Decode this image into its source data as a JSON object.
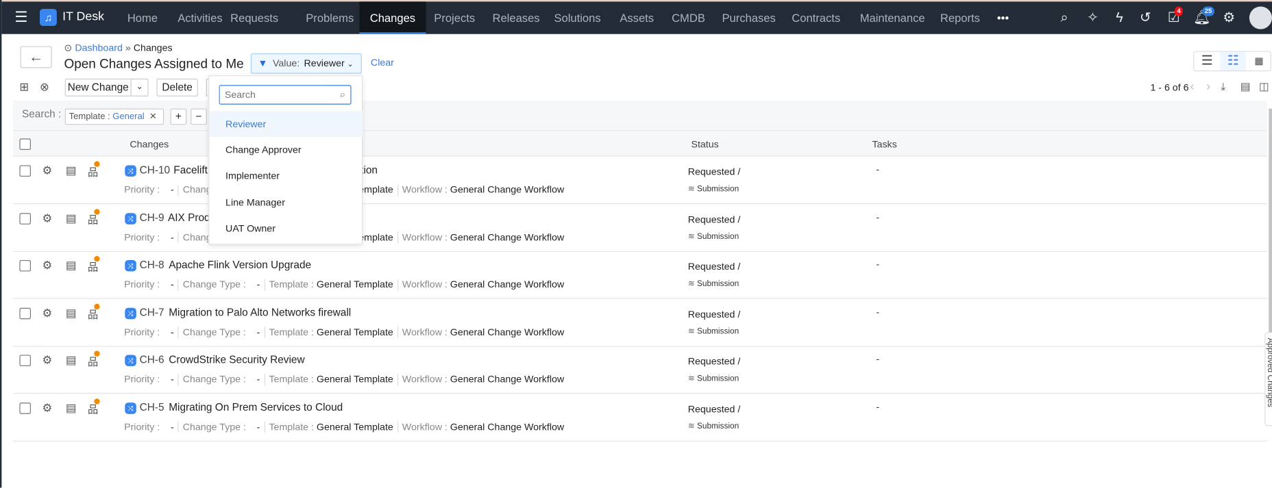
{
  "app": {
    "title": "IT Desk",
    "icon": "headset-icon"
  },
  "nav": {
    "items": [
      "Home",
      "Activities",
      "Requests",
      "Problems",
      "Changes",
      "Projects",
      "Releases",
      "Solutions",
      "Assets",
      "CMDB",
      "Purchases",
      "Contracts",
      "Maintenance",
      "Reports"
    ],
    "active": "Changes",
    "more": "•••"
  },
  "topbar": {
    "tasks_badge": "4",
    "notifications_badge": "25",
    "badge_colors": {
      "tasks": "#e8131b",
      "notifications": "#2f7de1"
    }
  },
  "breadcrumb": {
    "parent": "Dashboard",
    "current": "Changes"
  },
  "page": {
    "title": "Open Changes Assigned to Me"
  },
  "filter": {
    "label": "Value:",
    "value": "Reviewer",
    "clear": "Clear"
  },
  "dropdown": {
    "search_placeholder": "Search",
    "options": [
      "Reviewer",
      "Change Approver",
      "Implementer",
      "Line Manager",
      "UAT Owner"
    ],
    "selected": "Reviewer"
  },
  "toolbar": {
    "new_change": "New Change",
    "delete": "Delete",
    "pagination": "1 - 6 of 6"
  },
  "search": {
    "label": "Search :",
    "chip_key": "Template :",
    "chip_value": "General",
    "add": "+",
    "remove": "−"
  },
  "table": {
    "headers": {
      "changes": "Changes",
      "status": "Status",
      "tasks": "Tasks"
    },
    "meta_labels": {
      "priority": "Priority :",
      "change_type": "Change Type :",
      "template": "Template :",
      "workflow": "Workflow :"
    },
    "rows": [
      {
        "id": "CH-10",
        "title": "Facelift of Change Management Application",
        "priority": "-",
        "change_type": "-",
        "template": "General Template",
        "workflow": "General Change Workflow",
        "status": "Requested /",
        "stage": "Submission",
        "tasks": "-"
      },
      {
        "id": "CH-9",
        "title": "AIX Production Server Upgrade",
        "priority": "-",
        "change_type": "-",
        "template": "General Template",
        "workflow": "General Change Workflow",
        "status": "Requested /",
        "stage": "Submission",
        "tasks": "-"
      },
      {
        "id": "CH-8",
        "title": "Apache Flink Version Upgrade",
        "priority": "-",
        "change_type": "-",
        "template": "General Template",
        "workflow": "General Change Workflow",
        "status": "Requested /",
        "stage": "Submission",
        "tasks": "-"
      },
      {
        "id": "CH-7",
        "title": "Migration to Palo Alto Networks firewall",
        "priority": "-",
        "change_type": "-",
        "template": "General Template",
        "workflow": "General Change Workflow",
        "status": "Requested /",
        "stage": "Submission",
        "tasks": "-"
      },
      {
        "id": "CH-6",
        "title": "CrowdStrike Security Review",
        "priority": "-",
        "change_type": "-",
        "template": "General Template",
        "workflow": "General Change Workflow",
        "status": "Requested /",
        "stage": "Submission",
        "tasks": "-"
      },
      {
        "id": "CH-5",
        "title": "Migrating On Prem Services to Cloud",
        "priority": "-",
        "change_type": "-",
        "template": "General Template",
        "workflow": "General Change Workflow",
        "status": "Requested /",
        "stage": "Submission",
        "tasks": "-"
      }
    ]
  },
  "side_tab": {
    "label": "Approved Changes"
  },
  "colors": {
    "accent": "#3d8ef0",
    "topbar": "#232c36",
    "link": "#3a7bd5"
  }
}
